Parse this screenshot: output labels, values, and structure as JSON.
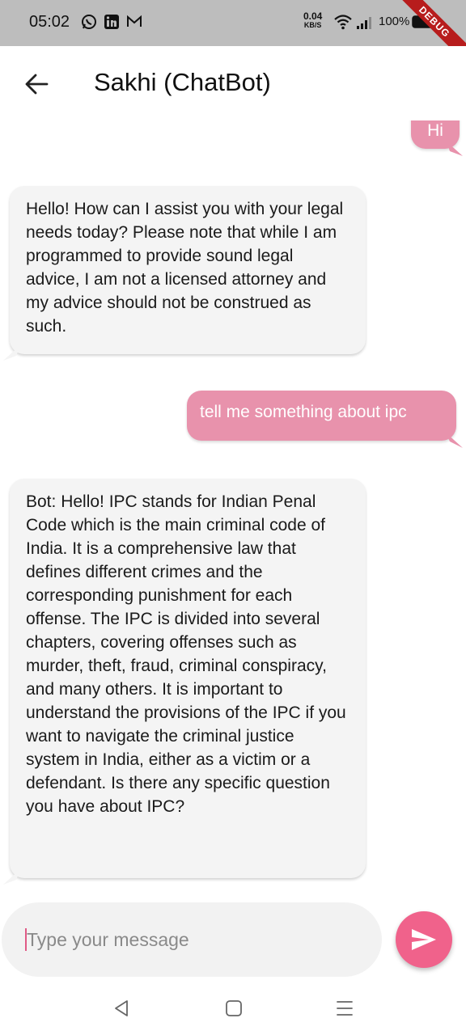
{
  "status_bar": {
    "time": "05:02",
    "net_speed_value": "0.04",
    "net_speed_unit": "KB/S",
    "battery_percent": "100%",
    "notification_icons": [
      "whatsapp-icon",
      "linkedin-icon",
      "gmail-icon"
    ]
  },
  "debug_banner": "DEBUG",
  "app_bar": {
    "title": "Sakhi (ChatBot)",
    "back_icon": "arrow-left-icon"
  },
  "messages": [
    {
      "sender": "user",
      "text": "Hi"
    },
    {
      "sender": "bot",
      "text": "Hello! How can I assist you with your legal needs today? Please note that while I am programmed to provide sound legal advice, I am not a licensed attorney and my advice should not be construed as such."
    },
    {
      "sender": "user",
      "text": "tell me something about ipc"
    },
    {
      "sender": "bot",
      "text": "Bot: Hello! IPC stands for Indian Penal Code which is the main criminal code of India. It is a comprehensive law that defines different crimes and the corresponding punishment for each offense. The IPC is divided into several chapters, covering offenses such as murder, theft, fraud, criminal conspiracy, and many others. It is important to understand the provisions of the IPC if you want to navigate the criminal justice system in India, either as a victim or a defendant. Is there any specific question you have about IPC?"
    }
  ],
  "composer": {
    "placeholder": "Type your message",
    "value": "",
    "send_icon": "send-icon"
  },
  "nav_bar": {
    "buttons": [
      "back-triangle-icon",
      "home-square-icon",
      "menu-lines-icon"
    ]
  },
  "colors": {
    "user_bubble": "#e892ac",
    "bot_bubble": "#f4f4f4",
    "send_button": "#f0628b",
    "status_bar": "#bdbdbd"
  }
}
